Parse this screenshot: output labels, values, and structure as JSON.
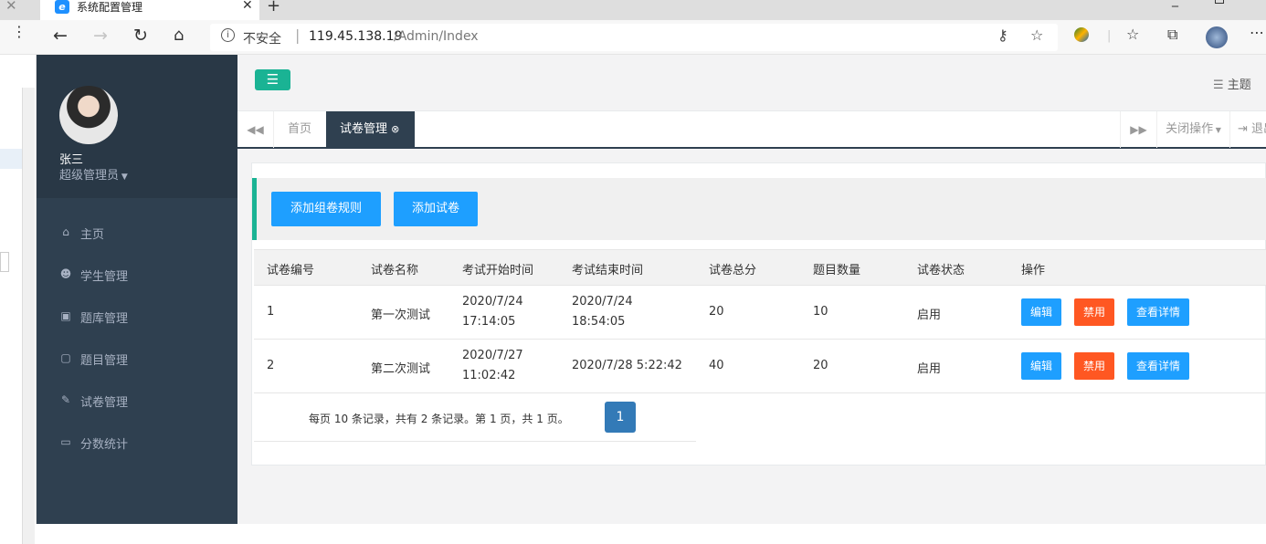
{
  "browser": {
    "tab_title": "系统配置管理",
    "tab_close": "✕",
    "new_tab": "+",
    "insecure_label": "不安全",
    "url_host": "119.45.138.19",
    "url_path": "/Admin/Index"
  },
  "sidebar": {
    "user_name": "张三",
    "user_role": "超级管理员",
    "items": [
      {
        "icon": "home-icon",
        "glyph": "⌂",
        "label": "主页"
      },
      {
        "icon": "users-icon",
        "glyph": "☻",
        "label": "学生管理"
      },
      {
        "icon": "briefcase-icon",
        "glyph": "▣",
        "label": "题库管理"
      },
      {
        "icon": "sticky-note-icon",
        "glyph": "▢",
        "label": "题目管理"
      },
      {
        "icon": "edit-icon",
        "glyph": "✎",
        "label": "试卷管理"
      },
      {
        "icon": "desktop-icon",
        "glyph": "▭",
        "label": "分数统计"
      }
    ]
  },
  "topbar": {
    "theme_label": "主题"
  },
  "tabs": {
    "home": "首页",
    "active": "试卷管理",
    "close_ops": "关闭操作",
    "logout": "退出"
  },
  "toolbar": {
    "add_rule": "添加组卷规则",
    "add_paper": "添加试卷"
  },
  "table": {
    "headers": [
      "试卷编号",
      "试卷名称",
      "考试开始时间",
      "考试结束时间",
      "试卷总分",
      "题目数量",
      "试卷状态",
      "操作"
    ],
    "rows": [
      {
        "id": "1",
        "name": "第一次测试",
        "start_date": "2020/7/24",
        "start_time": "17:14:05",
        "end_date": "2020/7/24",
        "end_time": "18:54:05",
        "total": "20",
        "count": "10",
        "status": "启用"
      },
      {
        "id": "2",
        "name": "第二次测试",
        "start_date": "2020/7/27",
        "start_time": "11:02:42",
        "end_date": "2020/7/28 5:22:42",
        "end_time": "",
        "total": "40",
        "count": "20",
        "status": "启用"
      }
    ],
    "actions": {
      "edit": "编辑",
      "disable": "禁用",
      "detail": "查看详情"
    }
  },
  "pager": {
    "info": "每页 10 条记录，共有 2 条记录。第 1 页，共 1 页。",
    "current_page": "1"
  },
  "colors": {
    "sidebar": "#2f4050",
    "accent": "#1ab394",
    "button_blue": "#1e9fff",
    "button_orange": "#ff5722",
    "page_blue": "#337ab7"
  }
}
